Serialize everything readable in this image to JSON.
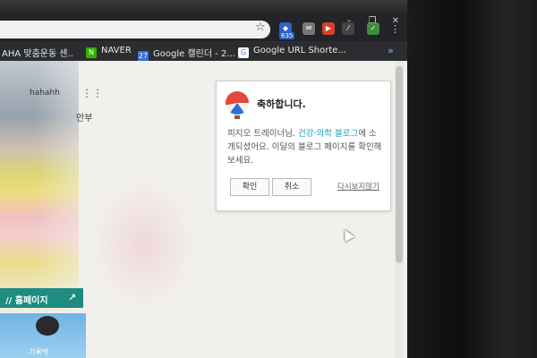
{
  "bookmarks": [
    {
      "label": "AHA 맞춤운동 센..",
      "icon": "bookmark-icon"
    },
    {
      "label": "NAVER",
      "icon": "naver-icon",
      "icon_glyph": "N",
      "color": "#2db400"
    },
    {
      "label": "Google 캘린더 - 2...",
      "icon": "calendar-icon",
      "icon_glyph": "27",
      "color": "#3b6fd8"
    },
    {
      "label": "Google URL Shorte...",
      "icon": "google-icon",
      "icon_glyph": "G",
      "color": "#4285f4"
    }
  ],
  "extensions": {
    "badge": "635"
  },
  "page": {
    "profile_name": "hahahh",
    "nav_text": "안부",
    "homepage_label": "// 홈페이지",
    "bottom_caption": "기록백"
  },
  "popup": {
    "title": "축하합니다.",
    "message_prefix": "피지오 트레이너님. ",
    "message_link": "건강·의학 블로그",
    "message_suffix": "에 소개되셨어요. 이달의 블로그 페이지를 확인해 보세요.",
    "ok_label": "확인",
    "cancel_label": "취소",
    "dont_show_label": "다시보지않기"
  }
}
